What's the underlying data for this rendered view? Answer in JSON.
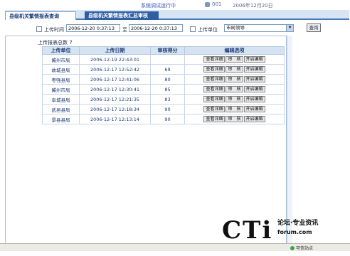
{
  "header": {
    "system_title": "系统调试运行中",
    "user": "001",
    "date": "2006年12月20日"
  },
  "tabs": [
    {
      "label": "县级机关繁情报表查询",
      "active": true
    },
    {
      "label": "县级机关繁情报表汇总审核",
      "active": false
    }
  ],
  "filter": {
    "upload_time_label": "上传时间",
    "from": "2006-12-20 0:37:13",
    "to_label": "至",
    "to": "2006-12-20 0:37:13",
    "unit_label": "上传单位",
    "unit_value": "市局领导",
    "query_button": "查询"
  },
  "summary": {
    "label": "上传报表总数",
    "count": "7"
  },
  "table": {
    "columns": [
      "上传单位",
      "上传日期",
      "审核得分",
      "编辑选项"
    ],
    "rows": [
      {
        "unit": "冀州市局",
        "date": "2006-12-19 22:43:01",
        "score": ""
      },
      {
        "unit": "故城县局",
        "date": "2006-12-17 12:52:42",
        "score": "69"
      },
      {
        "unit": "枣强县局",
        "date": "2006-12-17 12:41:06",
        "score": "80"
      },
      {
        "unit": "冀州市局",
        "date": "2006-12-17 12:30:41",
        "score": "85"
      },
      {
        "unit": "阜城县局",
        "date": "2006-12-17 12:21:35",
        "score": "83"
      },
      {
        "unit": "武邑县局",
        "date": "2006-12-17 12:18:34",
        "score": "90"
      },
      {
        "unit": "景县县局",
        "date": "2006-12-17 12:13:14",
        "score": "90"
      }
    ],
    "actions": [
      "查看详细",
      "审　核",
      "开启编辑"
    ]
  },
  "watermark": {
    "logo": "CTi",
    "tagline": "论坛·专业资讯",
    "url": "forum.com"
  },
  "statusbar": {
    "text": "可信站点"
  }
}
